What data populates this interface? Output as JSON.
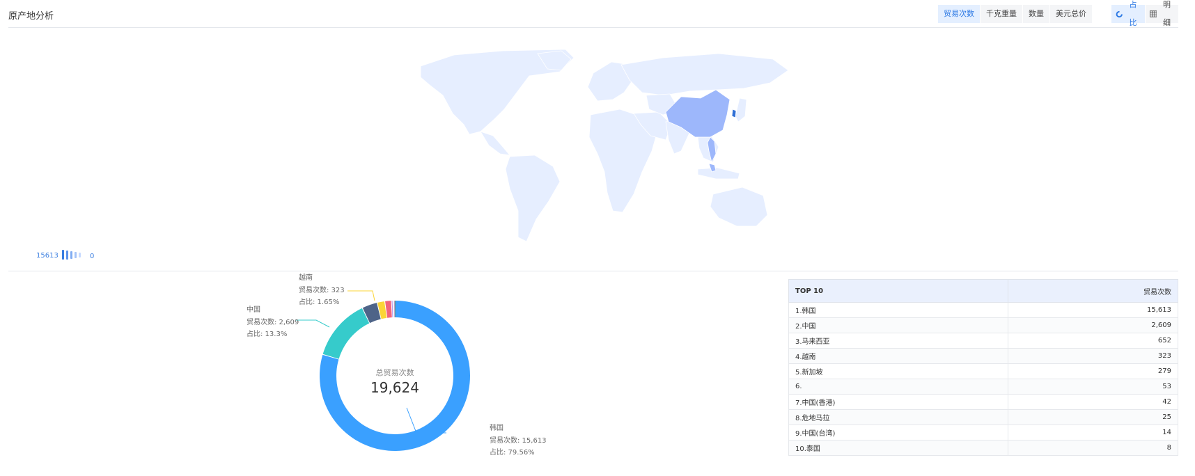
{
  "header": {
    "title": "原产地分析",
    "metrics": [
      {
        "label": "贸易次数",
        "active": true
      },
      {
        "label": "千克重量",
        "active": false
      },
      {
        "label": "数量",
        "active": false
      },
      {
        "label": "美元总价",
        "active": false
      }
    ],
    "views": [
      {
        "label": "占比",
        "icon": "donut-icon",
        "active": true
      },
      {
        "label": "明细",
        "icon": "grid-icon",
        "active": false
      }
    ]
  },
  "map": {
    "legend_max": "15613",
    "legend_min": "0",
    "colors": {
      "base": "#e6eeff",
      "mid": "#9db7fb",
      "high": "#2f6fd6"
    }
  },
  "donut": {
    "center_title": "总贸易次数",
    "center_value": "19,624",
    "callouts": {
      "korea": {
        "name": "韩国",
        "count_line": "贸易次数: 15,613",
        "share_line": "占比: 79.56%"
      },
      "china": {
        "name": "中国",
        "count_line": "贸易次数: 2,609",
        "share_line": "占比: 13.3%"
      },
      "vietnam": {
        "name": "越南",
        "count_line": "贸易次数: 323",
        "share_line": "占比: 1.65%"
      }
    }
  },
  "chart_data": {
    "type": "pie",
    "donut": true,
    "metric": "贸易次数",
    "total": 19624,
    "slices": [
      {
        "label": "韩国",
        "value": 15613,
        "color": "#3aa0ff"
      },
      {
        "label": "中国",
        "value": 2609,
        "color": "#36cbcb"
      },
      {
        "label": "马来西亚",
        "value": 652,
        "color": "#4e6488"
      },
      {
        "label": "越南",
        "value": 323,
        "color": "#fbd437"
      },
      {
        "label": "新加坡",
        "value": 279,
        "color": "#f2637b"
      },
      {
        "label": "6.",
        "value": 53,
        "color": "#975fe5"
      },
      {
        "label": "中国(香港)",
        "value": 42,
        "color": "#6dc8ec"
      },
      {
        "label": "危地马拉",
        "value": 25,
        "color": "#9270ca"
      },
      {
        "label": "中国(台湾)",
        "value": 14,
        "color": "#ff9845"
      },
      {
        "label": "泰国",
        "value": 8,
        "color": "#1e9493"
      }
    ]
  },
  "table": {
    "header_name": "TOP 10",
    "header_value": "贸易次数",
    "rows": [
      {
        "name": "1.韩国",
        "value": "15,613"
      },
      {
        "name": "2.中国",
        "value": "2,609"
      },
      {
        "name": "3.马来西亚",
        "value": "652"
      },
      {
        "name": "4.越南",
        "value": "323"
      },
      {
        "name": "5.新加坡",
        "value": "279"
      },
      {
        "name": "6.",
        "value": "53"
      },
      {
        "name": "7.中国(香港)",
        "value": "42"
      },
      {
        "name": "8.危地马拉",
        "value": "25"
      },
      {
        "name": "9.中国(台湾)",
        "value": "14"
      },
      {
        "name": "10.泰国",
        "value": "8"
      }
    ]
  }
}
